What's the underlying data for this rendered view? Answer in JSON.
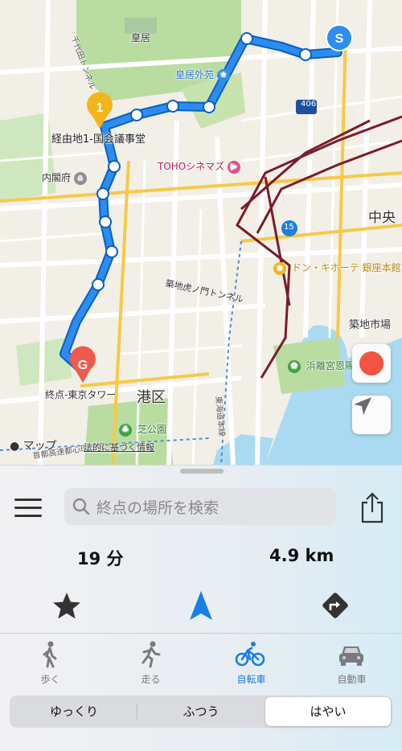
{
  "map": {
    "labels": {
      "kokyo": "皇居",
      "kokyo_gaien": "皇居外苑",
      "waypoint": "経由地1-国会議事堂",
      "naikakufu": "内閣府",
      "toho": "TOHOシネマズ",
      "chuo": "中央",
      "donki": "ドン・キホーテ 銀座本館",
      "toranomon_tunnel": "築地虎ノ門トンネル",
      "tsukiji": "築地市場",
      "hamarikyu": "浜離宮恩賜",
      "goal": "終点-東京タワー",
      "minato": "港区",
      "shiba_park": "芝公園",
      "route_406": "406",
      "route_15": "15",
      "chiyoda_tunnel": "千代田トンネル",
      "expressway": "東海道本線",
      "shutoko": "首都高速都心環状線",
      "attribution_brand": "マップ",
      "attribution_legal": "法的に基づく情報"
    },
    "markers": {
      "start": "S",
      "waypoint": "1",
      "goal": "G"
    },
    "colors": {
      "route": "#1a7de8",
      "route_outline": "#0b5fc2",
      "park": "#b9dca1",
      "water": "#aadaf2",
      "start": "#2f8cf0",
      "waypoint": "#f3b51a",
      "goal": "#ef5a4c"
    }
  },
  "controls": {
    "record_icon": "record-icon",
    "locate_icon": "location-arrow-icon"
  },
  "panel": {
    "search_placeholder": "終点の場所を検索",
    "duration": "19 分",
    "distance": "4.9 km",
    "tabs": [
      {
        "label": "歩く",
        "icon": "walk-icon",
        "active": false
      },
      {
        "label": "走る",
        "icon": "run-icon",
        "active": false
      },
      {
        "label": "自転車",
        "icon": "bicycle-icon",
        "active": true
      },
      {
        "label": "自動車",
        "icon": "car-icon",
        "active": false
      }
    ],
    "speeds": [
      {
        "label": "ゆっくり",
        "selected": false
      },
      {
        "label": "ふつう",
        "selected": false
      },
      {
        "label": "はやい",
        "selected": true
      }
    ],
    "accent": "#1a7de8"
  }
}
